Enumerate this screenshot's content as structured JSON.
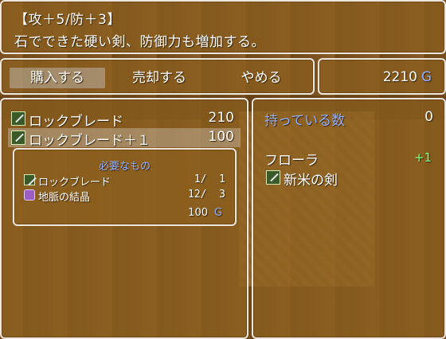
{
  "help": {
    "line1": "【攻＋5/防＋3】",
    "line2": "石でできた硬い剣、防御力も増加する。"
  },
  "commands": {
    "buy": "購入する",
    "sell": "売却する",
    "cancel": "やめる"
  },
  "gold": {
    "amount": "2210",
    "unit": "G"
  },
  "buy_list": [
    {
      "name": "ロックブレード",
      "price": "210",
      "icon": "sword-icon"
    },
    {
      "name": "ロックブレード＋１",
      "price": "100",
      "icon": "sword-icon"
    }
  ],
  "requirements": {
    "title": "必要なもの",
    "items": [
      {
        "name": "ロックブレード",
        "count": " 1/  1",
        "icon": "sword-icon"
      },
      {
        "name": "地脈の結晶",
        "count": "12/  3",
        "icon": "crystal-icon"
      }
    ],
    "cost": "100",
    "cost_unit": "G"
  },
  "status": {
    "possession_label": "持っている数",
    "possession_count": "0",
    "actor_name": "フローラ",
    "change": "+1",
    "equipped": "新米の剣"
  },
  "colors": {
    "window_bg": "#8c5f1e",
    "system_blue": "#8fb0ff",
    "increase_green": "#80ff80"
  }
}
